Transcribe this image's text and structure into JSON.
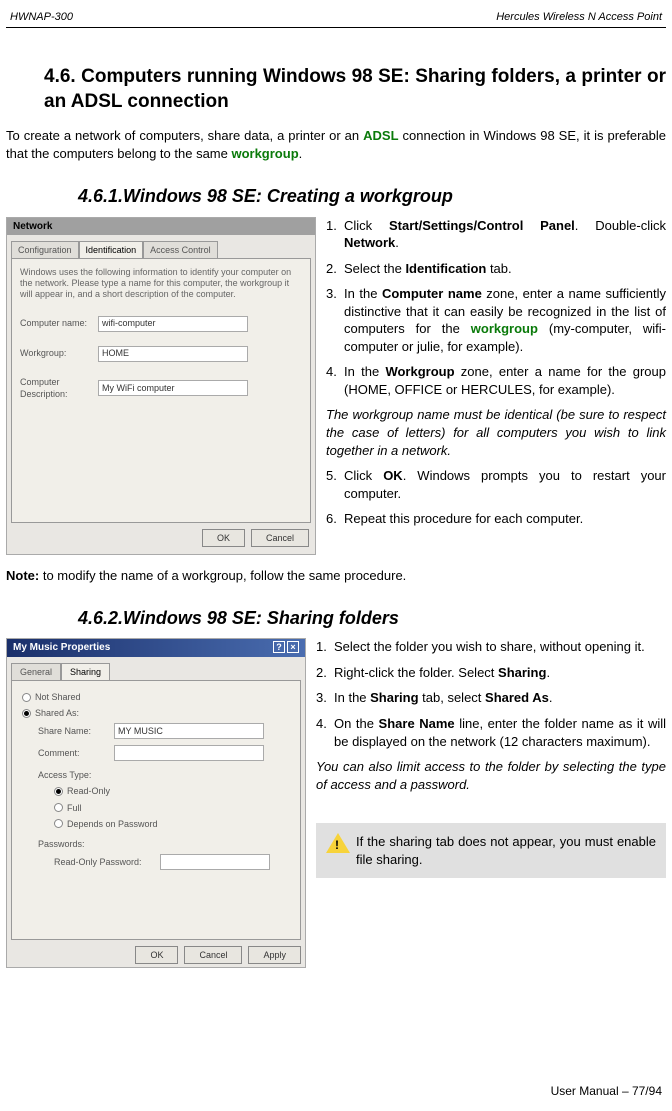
{
  "meta": {
    "doc_code": "HWNAP-300",
    "doc_title": "Hercules Wireless N Access Point",
    "footer": "User Manual – 77/94"
  },
  "section": {
    "heading_prefix": "4.6.",
    "heading_text": "Computers running Windows 98 SE: Sharing folders, a printer or an ADSL connection",
    "intro_a": "To create a network of computers, share data, a printer or an ",
    "intro_link1": "ADSL",
    "intro_b": " connection in Windows 98 SE, it is preferable that the computers belong to the same ",
    "intro_link2": "workgroup",
    "intro_c": "."
  },
  "sub461": {
    "heading": "4.6.1.Windows 98 SE: Creating a workgroup",
    "dialog": {
      "title": "Network",
      "tabs": {
        "t1": "Configuration",
        "t2": "Identification",
        "t3": "Access Control"
      },
      "desc": "Windows uses the following information to identify your computer on the network. Please type a name for this computer, the workgroup it will appear in, and a short description of the computer.",
      "labels": {
        "comp": "Computer name:",
        "wg": "Workgroup:",
        "cd": "Computer Description:"
      },
      "values": {
        "comp": "wifi-computer",
        "wg": "HOME",
        "cd": "My WiFi computer"
      },
      "buttons": {
        "ok": "OK",
        "cancel": "Cancel"
      }
    },
    "steps": {
      "s1a": "Click ",
      "s1b": "Start/Settings/Control Panel",
      "s1c": ". Double-click ",
      "s1d": "Network",
      "s1e": ".",
      "s2a": "Select the ",
      "s2b": "Identification",
      "s2c": " tab.",
      "s3a": "In the ",
      "s3b": "Computer name",
      "s3c": " zone, enter a name sufficiently distinctive that it can easily be recognized in the list of computers for the ",
      "s3d": "workgroup",
      "s3e": " (my-computer, wifi-computer or julie, for example).",
      "s4a": "In the ",
      "s4b": "Workgroup",
      "s4c": " zone, enter a name for the group (HOME, OFFICE or HERCULES, for example).",
      "italic": "The workgroup name must be identical (be sure to respect the case of letters) for all computers you wish to link together in a network.",
      "s5a": "Click ",
      "s5b": "OK",
      "s5c": ". Windows prompts you to restart your computer.",
      "s6": "Repeat this procedure for each computer."
    },
    "note_a": "Note:",
    "note_b": " to modify the name of a workgroup, follow the same procedure."
  },
  "sub462": {
    "heading": "4.6.2.Windows 98 SE: Sharing folders",
    "dialog": {
      "title": "My Music Properties",
      "tabs": {
        "t1": "General",
        "t2": "Sharing"
      },
      "radios": {
        "r1": "Not Shared",
        "r2": "Shared As:"
      },
      "labels": {
        "share": "Share Name:",
        "comment": "Comment:",
        "access": "Access Type:",
        "pw": "Passwords:",
        "ropw": "Read-Only Password:"
      },
      "values": {
        "share": "MY MUSIC"
      },
      "access_opts": {
        "ro": "Read-Only",
        "full": "Full",
        "dep": "Depends on Password"
      },
      "buttons": {
        "ok": "OK",
        "cancel": "Cancel",
        "apply": "Apply"
      }
    },
    "steps": {
      "s1": "Select the folder you wish to share, without opening it.",
      "s2a": "Right-click the folder.  Select ",
      "s2b": "Sharing",
      "s2c": ".",
      "s3a": "In the ",
      "s3b": "Sharing",
      "s3c": " tab, select ",
      "s3d": "Shared As",
      "s3e": ".",
      "s4a": "On the ",
      "s4b": "Share Name",
      "s4c": " line, enter the folder name as it will be displayed on the network (12 characters maximum).",
      "italic": "You can also limit access to the folder by selecting the type of access and a password."
    },
    "alert": "If the sharing tab does not appear, you must enable file sharing."
  }
}
